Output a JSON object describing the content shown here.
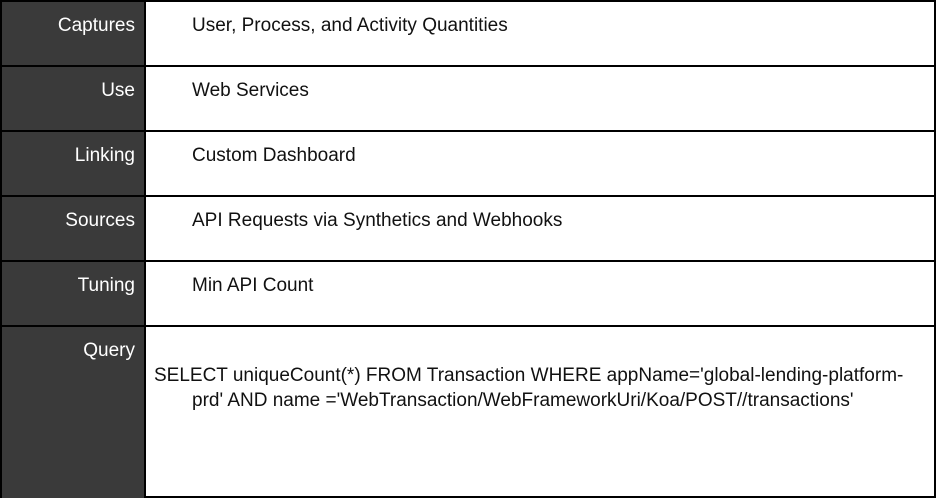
{
  "rows": [
    {
      "label": "Captures",
      "value": "User, Process, and Activity Quantities"
    },
    {
      "label": "Use",
      "value": "Web Services"
    },
    {
      "label": "Linking",
      "value": "Custom Dashboard"
    },
    {
      "label": "Sources",
      "value": "API Requests via Synthetics and Webhooks"
    },
    {
      "label": "Tuning",
      "value": "Min API Count"
    },
    {
      "label": "Query",
      "value": "SELECT uniqueCount(*) FROM Transaction WHERE appName='global-lending-platform-prd' AND name ='WebTransaction/WebFrameworkUri/Koa/POST//transactions'"
    }
  ],
  "colors": {
    "label_bg": "#3a3a3a",
    "label_text": "#ffffff",
    "border": "#000000",
    "value_text": "#111111"
  }
}
